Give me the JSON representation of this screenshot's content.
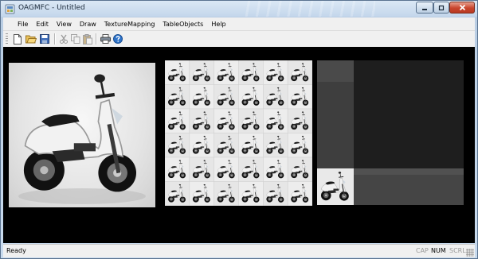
{
  "window": {
    "title": "OAGMFC - Untitled"
  },
  "menu": [
    {
      "label": "File"
    },
    {
      "label": "Edit"
    },
    {
      "label": "View"
    },
    {
      "label": "Draw"
    },
    {
      "label": "TextureMapping"
    },
    {
      "label": "TableObjects"
    },
    {
      "label": "Help"
    }
  ],
  "toolbar": {
    "buttons": [
      "new-icon",
      "open-icon",
      "save-icon",
      "cut-icon",
      "copy-icon",
      "paste-icon",
      "print-icon",
      "help-icon"
    ]
  },
  "canvas": {
    "panels": [
      "single-texture",
      "repeated-texture-grid",
      "clamped-texture"
    ],
    "grid_columns": 6,
    "grid_rows": 6,
    "colors": {
      "background": "#000000",
      "scooter_body": "#f2f2f2",
      "scooter_dark": "#1a1a1a"
    }
  },
  "status": {
    "text": "Ready",
    "indicators": [
      {
        "label": "CAP",
        "active": false
      },
      {
        "label": "NUM",
        "active": true
      },
      {
        "label": "SCRL",
        "active": false
      }
    ]
  }
}
